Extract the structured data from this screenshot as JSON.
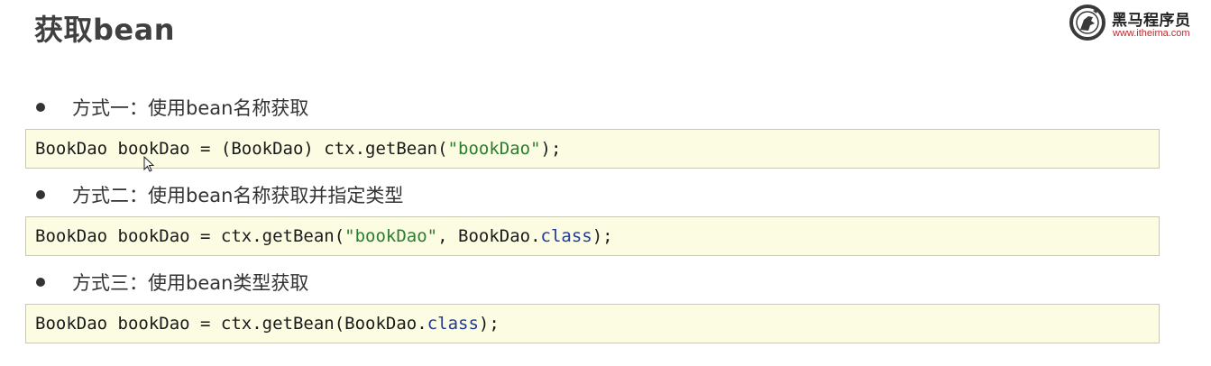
{
  "header": {
    "title": "获取bean",
    "logo": {
      "name": "黑马程序员",
      "url": "www.itheima.com",
      "icon": "horse-logo-icon"
    }
  },
  "methods": [
    {
      "label": "方式一：使用bean名称获取",
      "code": {
        "part1": "BookDao bookDao = (BookDao) ctx.getBean(",
        "string": "\"bookDao\"",
        "part2": ");"
      }
    },
    {
      "label": "方式二：使用bean名称获取并指定类型",
      "code": {
        "part1": "BookDao bookDao = ctx.getBean(",
        "string": "\"bookDao\"",
        "part2": ", BookDao.",
        "keyword": "class",
        "part3": ");"
      }
    },
    {
      "label": "方式三：使用bean类型获取",
      "code": {
        "part1": "BookDao bookDao = ctx.getBean(BookDao.",
        "keyword": "class",
        "part2": ");"
      }
    }
  ],
  "colors": {
    "code_background": "#fcfce3",
    "string_literal": "#2a7d2e",
    "keyword": "#1f3a93",
    "brand_red": "#c0282d"
  },
  "cursor": {
    "icon": "mouse-pointer-icon"
  }
}
